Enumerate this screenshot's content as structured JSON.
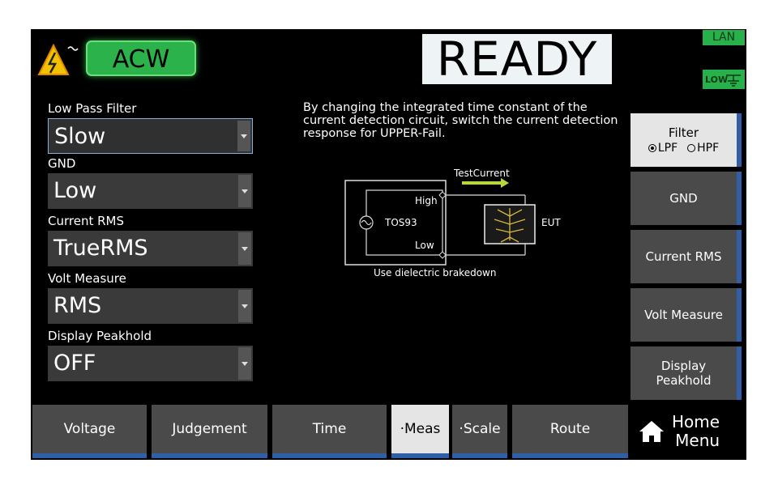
{
  "header": {
    "mode": "ACW",
    "status": "READY",
    "lan": "LAN",
    "low_badge": "LOW"
  },
  "settings": [
    {
      "label": "Low Pass Filter",
      "value": "Slow"
    },
    {
      "label": "GND",
      "value": "Low"
    },
    {
      "label": "Current RMS",
      "value": "TrueRMS"
    },
    {
      "label": "Volt Measure",
      "value": "RMS"
    },
    {
      "label": "Display Peakhold",
      "value": "OFF"
    }
  ],
  "description": "By changing the integrated time constant of the current detection circuit, switch the current detection response for UPPER-Fail.",
  "diagram": {
    "test_current": "TestCurrent",
    "high": "High",
    "instrument": "TOS93",
    "low": "Low",
    "eut": "EUT",
    "caption": "Use dielectric brakedown"
  },
  "softkeys": {
    "filter": {
      "title": "Filter",
      "options": [
        "LPF",
        "HPF"
      ],
      "selected": "LPF"
    },
    "gnd": "GND",
    "current_rms": "Current RMS",
    "volt_measure": "Volt Measure",
    "display_peakhold_line1": "Display",
    "display_peakhold_line2": "Peakhold"
  },
  "bottom_tabs": {
    "voltage": "Voltage",
    "judgement": "Judgement",
    "time": "Time",
    "meas": "·Meas",
    "scale": "·Scale",
    "route": "Route",
    "home_line1": "Home",
    "home_line2": "Menu"
  },
  "colors": {
    "accent_green": "#2bb24a",
    "softkey_gray": "#4a4a4a",
    "selected_light": "#e5e5e5",
    "tab_blue": "#2f5fa6",
    "arrow_green": "#b6d83a"
  }
}
